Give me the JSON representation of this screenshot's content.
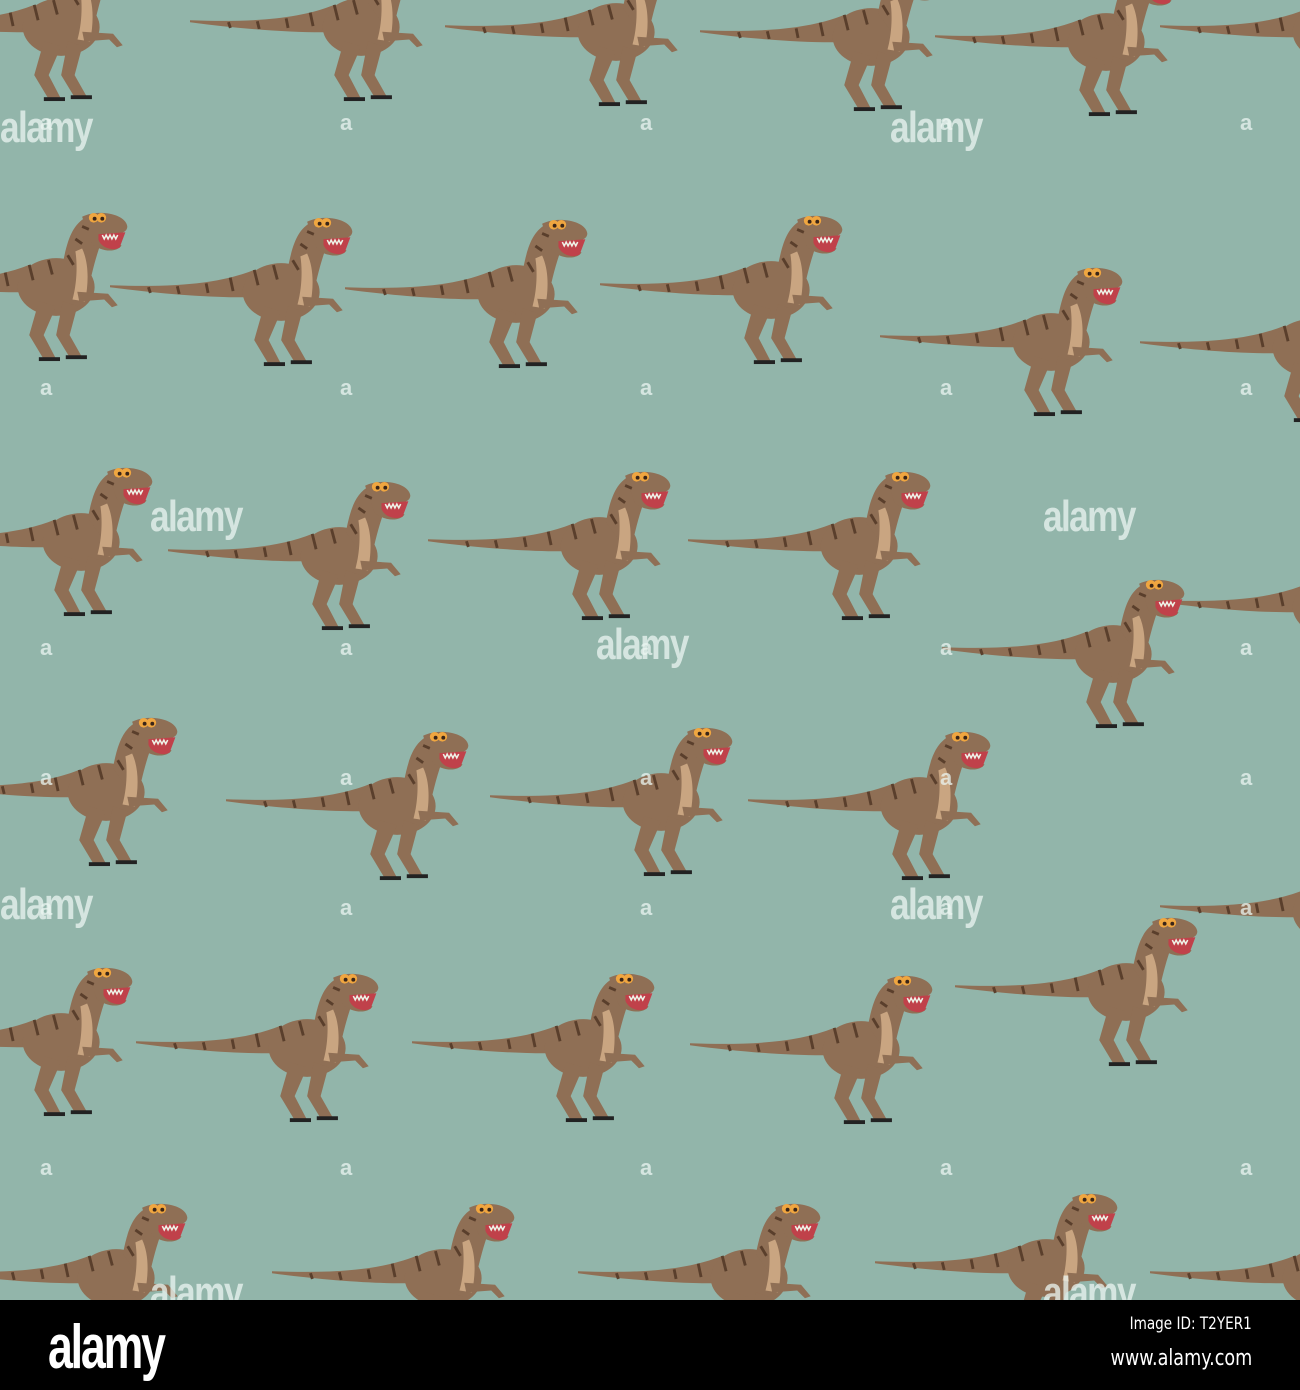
{
  "colors": {
    "background": "#92b5aa",
    "dino_body": "#8f6f55",
    "dino_belly": "#c9a581",
    "dino_stripe": "#5a3f2c",
    "footer": "#000000"
  },
  "watermark": {
    "text": "alamy",
    "small": "a"
  },
  "footer": {
    "logo": "alamy",
    "image_id": "Image ID: T2YER1",
    "url": "www.alamy.com"
  }
}
